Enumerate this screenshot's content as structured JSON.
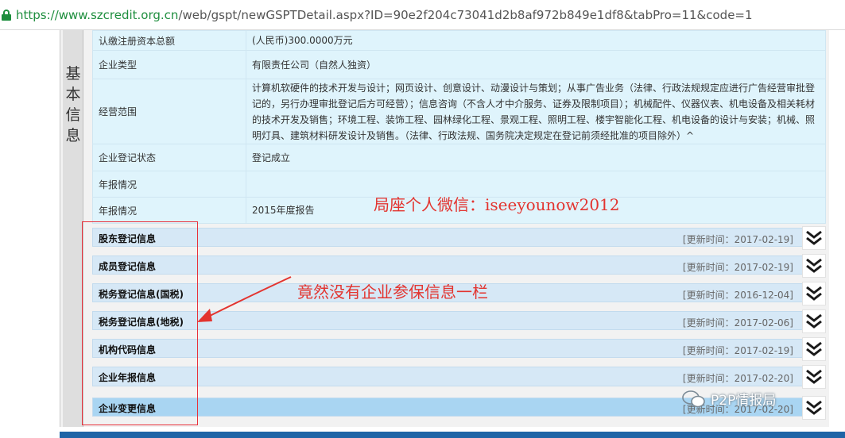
{
  "browser": {
    "url_scheme_host": "https://www.szcredit.org.cn",
    "url_path": "/web/gspt/newGSPTDetail.aspx?ID=90e2f204c73041d2b8af972b849e1df8&tabPro=11&code=1"
  },
  "side": {
    "label": "基本信息"
  },
  "info_rows": [
    {
      "label": "认缴注册资本总额",
      "value": "(人民币)300.0000万元"
    },
    {
      "label": "企业类型",
      "value": "有限责任公司（自然人独资）"
    },
    {
      "label": "经营范围",
      "value": "计算机软硬件的技术开发与设计；网页设计、创意设计、动漫设计与策划；从事广告业务（法律、行政法规规定应进行广告经营审批登记的，另行办理审批登记后方可经营）；信息咨询（不含人才中介服务、证券及限制项目）；机械配件、仪器仪表、机电设备及相关耗材的技术开发及销售；环境工程、装饰工程、园林绿化工程、景观工程、照明工程、楼宇智能化工程、机电设备的设计与安装；机械、照明灯具、建筑材料研发设计及销售。（法律、行政法规、国务院决定规定在登记前须经批准的项目除外）^"
    },
    {
      "label": "企业登记状态",
      "value": "登记成立"
    },
    {
      "label": "年报情况",
      "value": ""
    },
    {
      "label": "年报情况",
      "value": "2015年度报告"
    }
  ],
  "sections": [
    {
      "title": "股东登记信息",
      "updated": "[更新时间：2017-02-19]"
    },
    {
      "title": "成员登记信息",
      "updated": "[更新时间：2017-02-19]"
    },
    {
      "title": "税务登记信息(国税)",
      "updated": "[更新时间：2016-12-04]"
    },
    {
      "title": "税务登记信息(地税)",
      "updated": "[更新时间：2017-02-06]"
    },
    {
      "title": "机构代码信息",
      "updated": "[更新时间：2017-02-19]"
    },
    {
      "title": "企业年报信息",
      "updated": "[更新时间：2017-02-20]"
    },
    {
      "title": "企业变更信息",
      "updated": "[更新时间：2017-02-20]"
    }
  ],
  "annotations": {
    "wechat": "局座个人微信：iseeyounow2012",
    "missing": "竟然没有企业参保信息一栏"
  },
  "watermark": {
    "text": "P2P情报局",
    "icon": "wechat-icon"
  },
  "colors": {
    "info_bg": "#dff4fc",
    "section_bg": "#d6e8f6",
    "annotation": "#e3342f",
    "url_green": "#1e8e3e"
  }
}
